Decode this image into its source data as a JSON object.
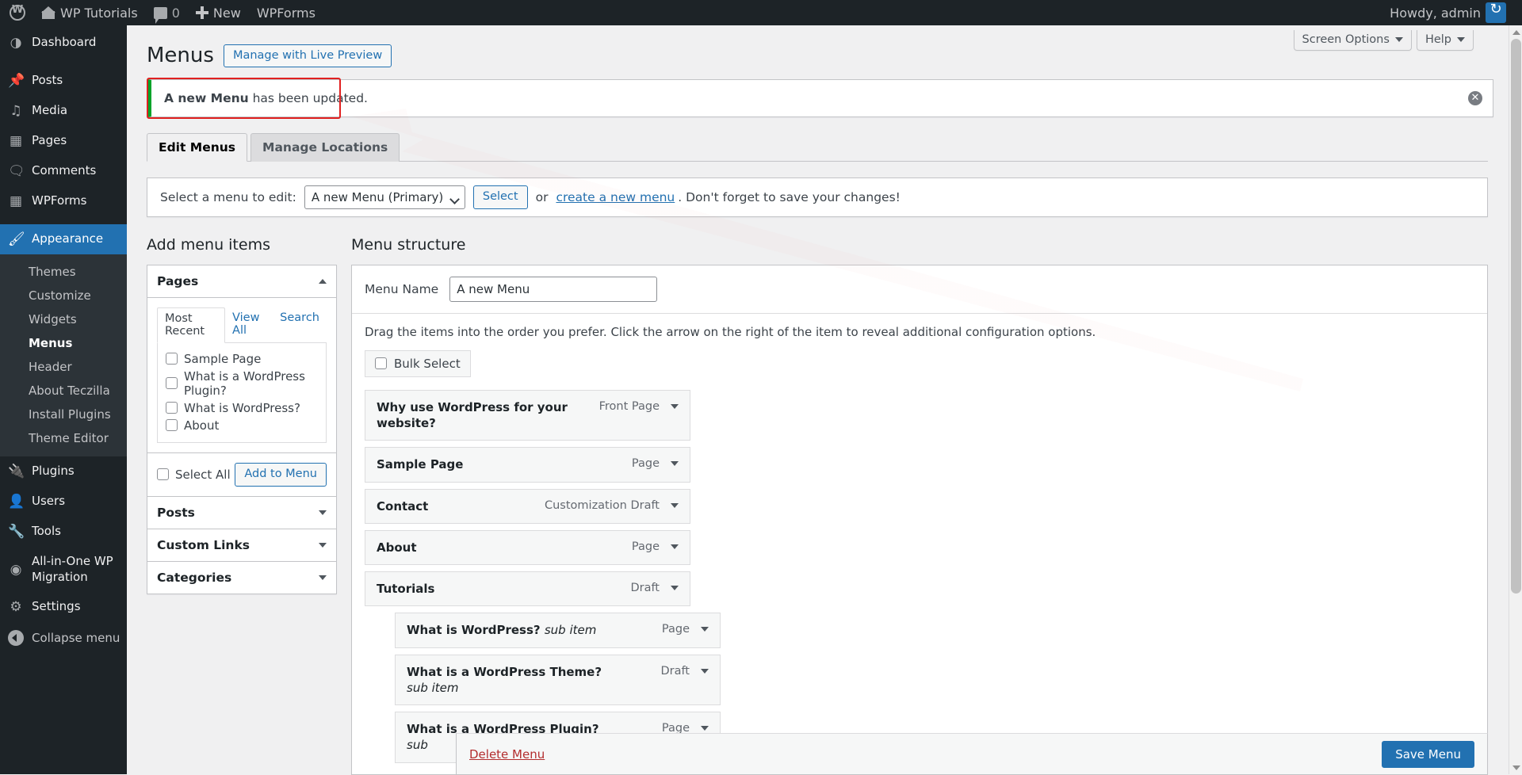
{
  "adminbar": {
    "logo_icon": "wordpress-logo-icon",
    "site_name": "WP Tutorials",
    "home_icon": "home-icon",
    "comments_icon": "comment-bubble-icon",
    "comment_count": "0",
    "new_icon": "plus-icon",
    "new_label": "New",
    "wpforms_label": "WPForms",
    "howdy": "Howdy, admin",
    "avatar_icon": "user-avatar-icon"
  },
  "sidebar": {
    "items": [
      {
        "label": "Dashboard",
        "icon": "dashboard-gauge-icon",
        "glyph": "◔"
      },
      {
        "label": "Posts",
        "icon": "pin-icon",
        "glyph": "✒"
      },
      {
        "label": "Media",
        "icon": "media-music-icon",
        "glyph": "♫"
      },
      {
        "label": "Pages",
        "icon": "pages-icon",
        "glyph": "▤"
      },
      {
        "label": "Comments",
        "icon": "comment-bubble-icon",
        "glyph": "■"
      },
      {
        "label": "WPForms",
        "icon": "wpforms-clipboard-icon",
        "glyph": "▦"
      },
      {
        "label": "Appearance",
        "icon": "paintbrush-icon",
        "glyph": "✒",
        "current": true
      },
      {
        "label": "Plugins",
        "icon": "plug-icon",
        "glyph": "⚡"
      },
      {
        "label": "Users",
        "icon": "user-icon",
        "glyph": "☻"
      },
      {
        "label": "Tools",
        "icon": "wrench-icon",
        "glyph": "⚒"
      },
      {
        "label": "All-in-One WP Migration",
        "icon": "migration-swirl-icon",
        "glyph": "◎"
      },
      {
        "label": "Settings",
        "icon": "sliders-icon",
        "glyph": "⚙"
      }
    ],
    "appearance_submenu": [
      {
        "label": "Themes"
      },
      {
        "label": "Customize"
      },
      {
        "label": "Widgets"
      },
      {
        "label": "Menus",
        "current": true
      },
      {
        "label": "Header"
      },
      {
        "label": "About Teczilla"
      },
      {
        "label": "Install Plugins"
      },
      {
        "label": "Theme Editor"
      }
    ],
    "collapse_label": "Collapse menu",
    "collapse_icon": "collapse-arrow-icon"
  },
  "screen_meta": {
    "screen_options": "Screen Options",
    "help": "Help"
  },
  "header": {
    "title": "Menus",
    "live_preview_button": "Manage with Live Preview"
  },
  "notice": {
    "text_bold": "A new Menu",
    "text_rest": " has been updated.",
    "dismiss_icon": "dismiss-close-icon",
    "accent_color": "#00a32a",
    "highlight_color": "#e02020"
  },
  "tabs": [
    {
      "label": "Edit Menus",
      "active": true
    },
    {
      "label": "Manage Locations",
      "active": false
    }
  ],
  "menu_select_bar": {
    "label": "Select a menu to edit:",
    "selected_option": "A new Menu (Primary)",
    "options": [
      "A new Menu (Primary)"
    ],
    "select_button": "Select",
    "or_text": "or ",
    "create_link": "create a new menu",
    "tail_text": ". Don't forget to save your changes!"
  },
  "add_menu_items": {
    "heading": "Add menu items",
    "pages": {
      "title": "Pages",
      "toggle_icon": "chevron-up-icon",
      "tabs": [
        {
          "label": "Most Recent",
          "active": true
        },
        {
          "label": "View All",
          "active": false
        },
        {
          "label": "Search",
          "active": false
        }
      ],
      "items": [
        "Sample Page",
        "What is a WordPress Plugin?",
        "What is WordPress?",
        "About"
      ],
      "select_all": "Select All",
      "add_button": "Add to Menu"
    },
    "collapsed_sections": [
      {
        "title": "Posts",
        "toggle_icon": "chevron-down-icon"
      },
      {
        "title": "Custom Links",
        "toggle_icon": "chevron-down-icon"
      },
      {
        "title": "Categories",
        "toggle_icon": "chevron-down-icon"
      }
    ]
  },
  "menu_structure": {
    "heading": "Menu structure",
    "name_label": "Menu Name",
    "name_value": "A new Menu",
    "hint": "Drag the items into the order you prefer. Click the arrow on the right of the item to reveal additional configuration options.",
    "bulk_select": "Bulk Select",
    "items": [
      {
        "title": "Why use WordPress for your website?",
        "sub": "",
        "type": "Front Page",
        "depth": 0,
        "toggle_icon": "chevron-down-icon"
      },
      {
        "title": "Sample Page",
        "sub": "",
        "type": "Page",
        "depth": 0,
        "toggle_icon": "chevron-down-icon"
      },
      {
        "title": "Contact",
        "sub": "",
        "type": "Customization Draft",
        "depth": 0,
        "toggle_icon": "chevron-down-icon"
      },
      {
        "title": "About",
        "sub": "",
        "type": "Page",
        "depth": 0,
        "toggle_icon": "chevron-down-icon"
      },
      {
        "title": "Tutorials",
        "sub": "",
        "type": "Draft",
        "depth": 0,
        "toggle_icon": "chevron-down-icon"
      },
      {
        "title": "What is WordPress?",
        "sub": "sub item",
        "type": "Page",
        "depth": 1,
        "toggle_icon": "chevron-down-icon"
      },
      {
        "title": "What is a WordPress Theme?",
        "sub": "sub item",
        "type": "Draft",
        "depth": 1,
        "toggle_icon": "chevron-down-icon"
      },
      {
        "title": "What is a WordPress Plugin?",
        "sub": "sub",
        "type": "Page",
        "depth": 1,
        "toggle_icon": "chevron-down-icon"
      }
    ],
    "delete_link": "Delete Menu",
    "save_button": "Save Menu"
  },
  "annotation": {
    "type": "red-arrow",
    "color": "#e8342a",
    "points_to": "A new Menu has been updated. notice"
  }
}
